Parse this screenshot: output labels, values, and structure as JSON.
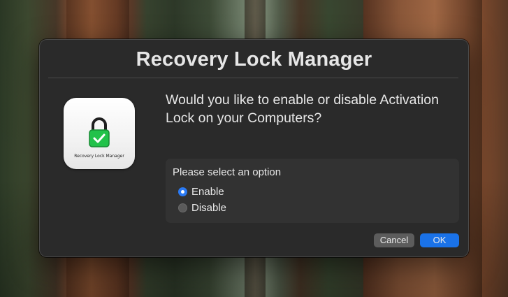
{
  "dialog": {
    "title": "Recovery Lock Manager",
    "icon": {
      "name": "padlock-checkmark-icon",
      "caption": "Recovery Lock Manager",
      "colors": {
        "lock": "#22c24a",
        "shackle": "#1f1f1f",
        "check": "#ffffff"
      }
    },
    "question": "Would you like to enable or disable Activation Lock on your Computers?",
    "options": {
      "label": "Please select an option",
      "selected": "Enable",
      "items": [
        {
          "label": "Enable",
          "checked": true
        },
        {
          "label": "Disable",
          "checked": false
        }
      ]
    },
    "buttons": {
      "cancel": "Cancel",
      "ok": "OK"
    }
  },
  "colors": {
    "dialog_bg": "#2a2a2a",
    "accent": "#1a72e8",
    "text": "#e8e8e8"
  }
}
